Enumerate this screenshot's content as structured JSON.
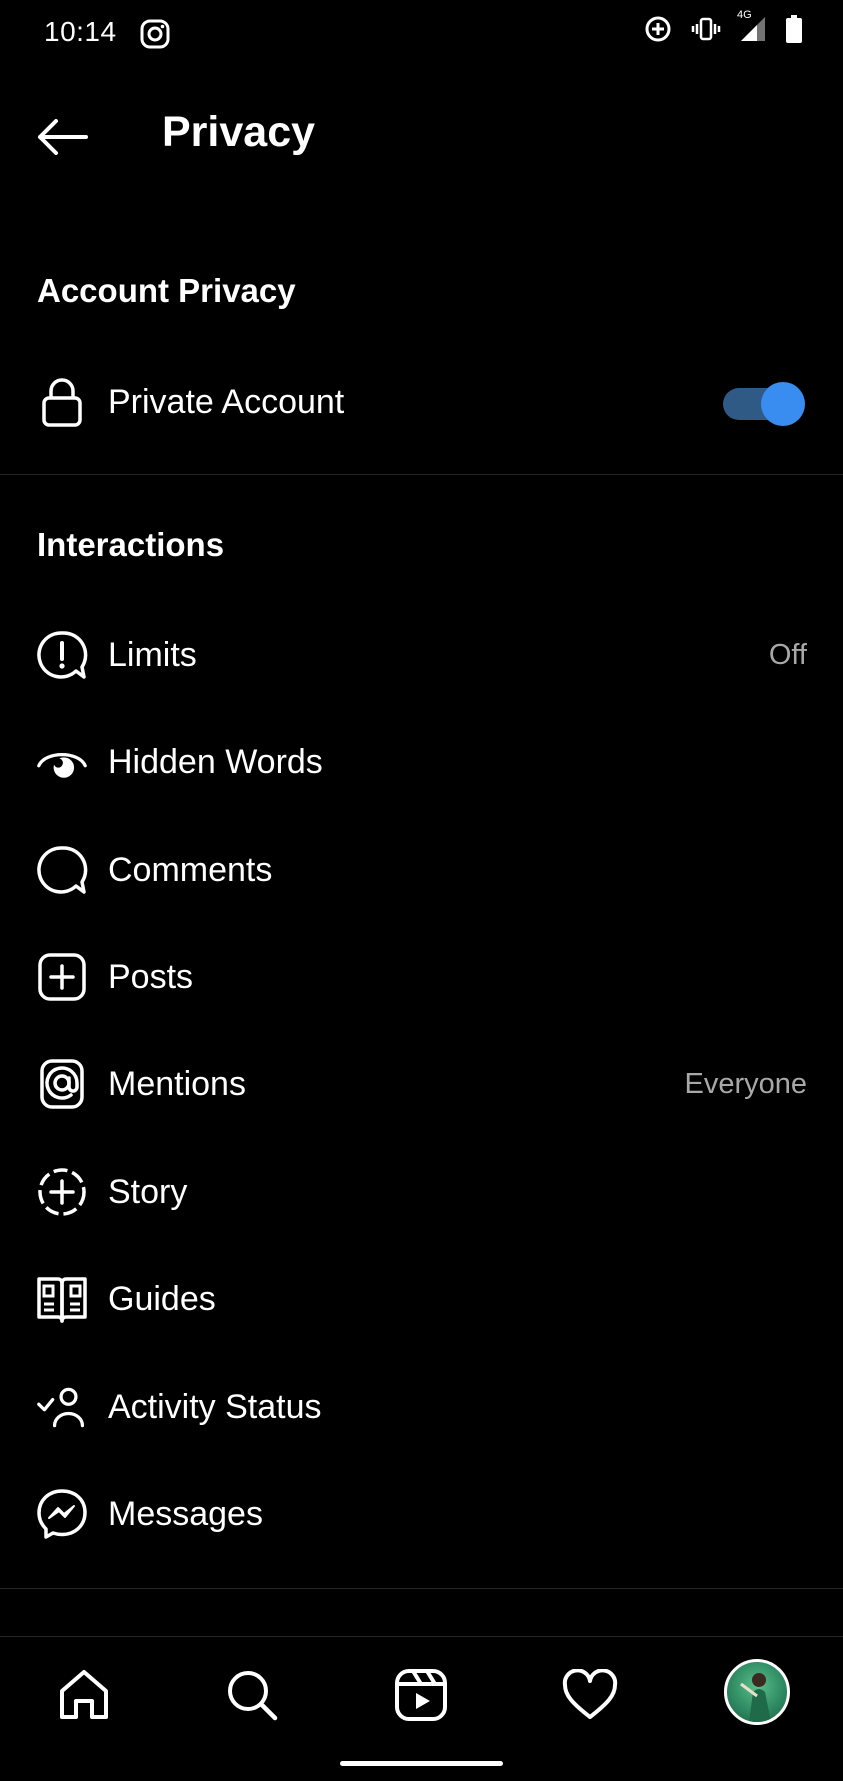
{
  "status_bar": {
    "time": "10:14",
    "network": "4G"
  },
  "header": {
    "title": "Privacy"
  },
  "sections": {
    "account_privacy": {
      "title": "Account Privacy",
      "private_account_label": "Private Account",
      "private_account_enabled": true
    },
    "interactions": {
      "title": "Interactions",
      "items": [
        {
          "label": "Limits",
          "value": "Off",
          "icon": "limits-icon"
        },
        {
          "label": "Hidden Words",
          "value": "",
          "icon": "hidden-words-icon"
        },
        {
          "label": "Comments",
          "value": "",
          "icon": "comment-icon"
        },
        {
          "label": "Posts",
          "value": "",
          "icon": "add-post-icon"
        },
        {
          "label": "Mentions",
          "value": "Everyone",
          "icon": "mention-icon"
        },
        {
          "label": "Story",
          "value": "",
          "icon": "story-icon"
        },
        {
          "label": "Guides",
          "value": "",
          "icon": "guides-icon"
        },
        {
          "label": "Activity Status",
          "value": "",
          "icon": "activity-status-icon"
        },
        {
          "label": "Messages",
          "value": "",
          "icon": "messenger-icon"
        }
      ]
    }
  },
  "colors": {
    "background": "#000000",
    "toggle_track": "#2f5a86",
    "toggle_knob": "#3a8df0",
    "secondary_text": "#a8a8a8",
    "divider": "#262626"
  }
}
